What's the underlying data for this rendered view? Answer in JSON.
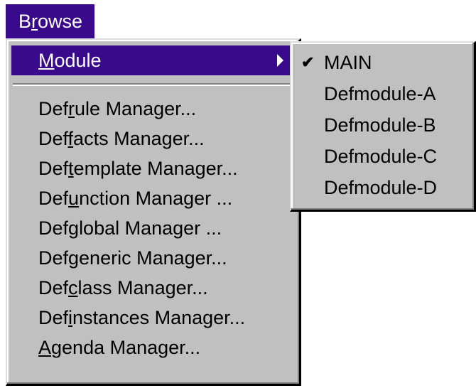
{
  "menubar": {
    "browse_label": "Browse",
    "browse_mnemonic_pre": "B",
    "browse_mnemonic": "r",
    "browse_mnemonic_post": "owse"
  },
  "menu": {
    "items": [
      {
        "pre": "",
        "mn": "M",
        "post": "odule",
        "has_submenu": true,
        "active": true
      },
      {
        "pre": "Def",
        "mn": "r",
        "post": "ule Manager..."
      },
      {
        "pre": "Def",
        "mn": "f",
        "post": "acts Manager..."
      },
      {
        "pre": "Def",
        "mn": "t",
        "post": "emplate Manager..."
      },
      {
        "pre": "Def",
        "mn": "u",
        "post": "nction Manager ..."
      },
      {
        "pre": "Def",
        "mn": "g",
        "post": "lobal Manager ..."
      },
      {
        "pre": "Defgeneric Manager...",
        "mn": "",
        "post": ""
      },
      {
        "pre": "Def",
        "mn": "c",
        "post": "lass Manager..."
      },
      {
        "pre": "Def",
        "mn": "i",
        "post": "nstances Manager..."
      },
      {
        "pre": "",
        "mn": "A",
        "post": "genda Manager..."
      }
    ]
  },
  "submenu": {
    "check_glyph": "✔",
    "items": [
      {
        "label": "MAIN",
        "checked": true
      },
      {
        "label": "Defmodule-A",
        "checked": false
      },
      {
        "label": "Defmodule-B",
        "checked": false
      },
      {
        "label": "Defmodule-C",
        "checked": false
      },
      {
        "label": "Defmodule-D",
        "checked": false
      }
    ]
  },
  "colors": {
    "highlight": "#3a0a8c",
    "menu_bg": "#c0c0c0"
  }
}
